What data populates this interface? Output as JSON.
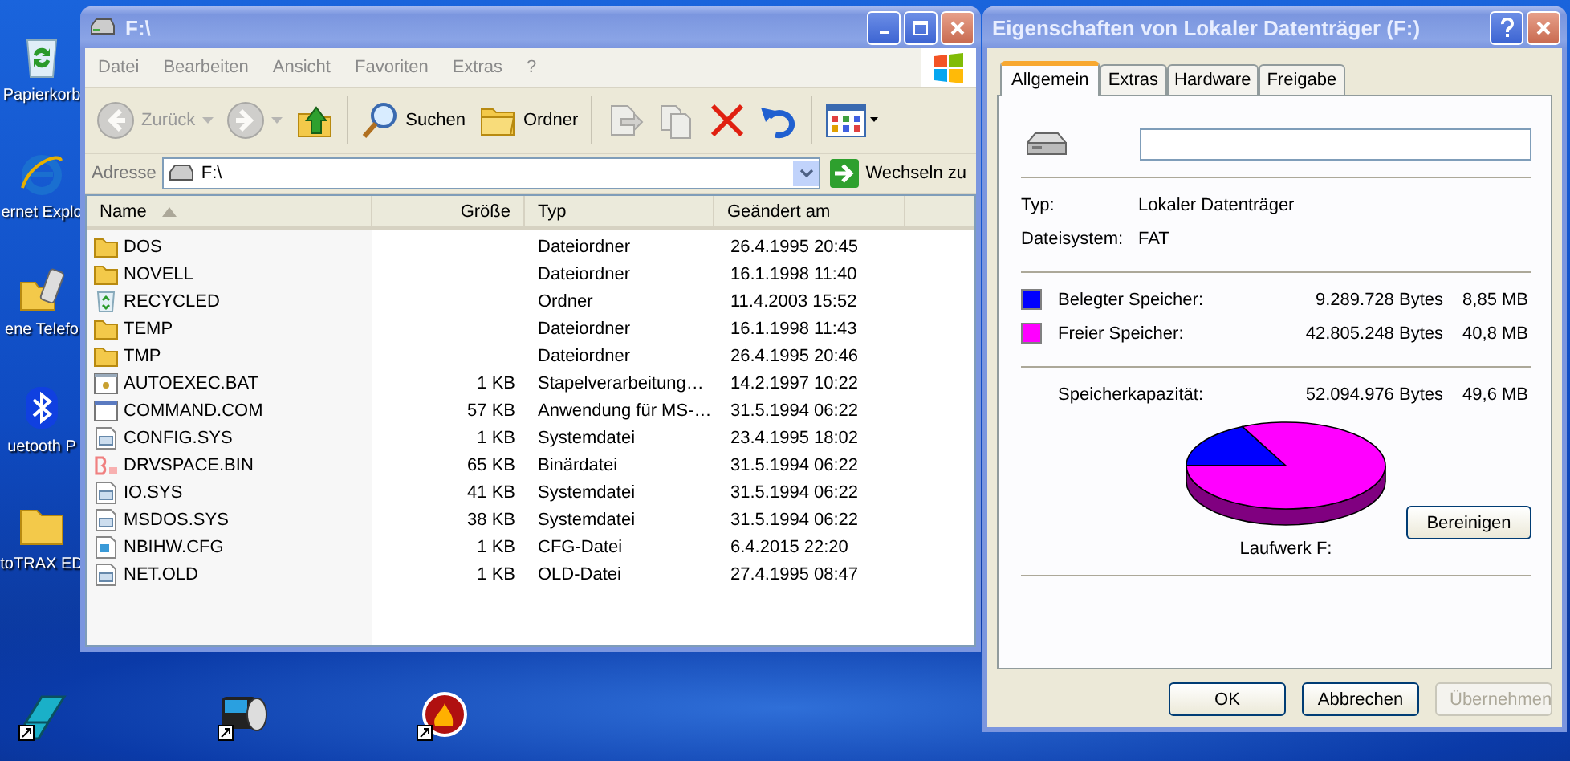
{
  "desktop_icons": [
    {
      "kind": "recycle",
      "label": "Papierkorb"
    },
    {
      "kind": "browser",
      "label": "ernet Explo"
    },
    {
      "kind": "phone",
      "label": "ene Telefo"
    },
    {
      "kind": "bluetooth",
      "label": "uetooth P"
    },
    {
      "kind": "folder",
      "label": "toTRAX ED"
    }
  ],
  "bottom_icons": [
    {
      "kind": "shortcut-cyan"
    },
    {
      "kind": "shortcut-printer"
    },
    {
      "kind": "shortcut-flame"
    }
  ],
  "explorer": {
    "title": "F:\\",
    "menu": [
      "Datei",
      "Bearbeiten",
      "Ansicht",
      "Favoriten",
      "Extras",
      "?"
    ],
    "toolbar": [
      {
        "kind": "back",
        "label": "Zurück",
        "disabled": true
      },
      {
        "kind": "forward",
        "disabled": true
      },
      {
        "kind": "up",
        "disabled": false
      },
      {
        "kind": "search",
        "label": "Suchen",
        "disabled": false
      },
      {
        "kind": "folders",
        "label": "Ordner",
        "disabled": false
      },
      {
        "kind": "move",
        "disabled": true
      },
      {
        "kind": "copy",
        "disabled": true
      },
      {
        "kind": "delete",
        "disabled": false
      },
      {
        "kind": "undo",
        "disabled": false
      },
      {
        "kind": "views",
        "disabled": false
      }
    ],
    "address": {
      "label": "Adresse",
      "value": "F:\\",
      "go": "Wechseln zu"
    },
    "columns": [
      {
        "label": "Name",
        "sorted": true
      },
      {
        "label": "Größe",
        "sorted": false
      },
      {
        "label": "Typ",
        "sorted": false
      },
      {
        "label": "Geändert am",
        "sorted": false
      }
    ],
    "rows": [
      {
        "kind": "folder",
        "name": "DOS",
        "size": "",
        "type": "Dateiordner",
        "modified": "26.4.1995 20:45"
      },
      {
        "kind": "folder",
        "name": "NOVELL",
        "size": "",
        "type": "Dateiordner",
        "modified": "16.1.1998 11:40"
      },
      {
        "kind": "recycled",
        "name": "RECYCLED",
        "size": "",
        "type": "Ordner",
        "modified": "11.4.2003 15:52"
      },
      {
        "kind": "folder",
        "name": "TEMP",
        "size": "",
        "type": "Dateiordner",
        "modified": "16.1.1998 11:43"
      },
      {
        "kind": "folder",
        "name": "TMP",
        "size": "",
        "type": "Dateiordner",
        "modified": "26.4.1995 20:46"
      },
      {
        "kind": "batch",
        "name": "AUTOEXEC.BAT",
        "size": "1 KB",
        "type": "Stapelverarbeitung…",
        "modified": "14.2.1997 10:22"
      },
      {
        "kind": "app",
        "name": "COMMAND.COM",
        "size": "57 KB",
        "type": "Anwendung für MS-…",
        "modified": "31.5.1994 06:22"
      },
      {
        "kind": "system",
        "name": "CONFIG.SYS",
        "size": "1 KB",
        "type": "Systemdatei",
        "modified": "23.4.1995 18:02"
      },
      {
        "kind": "binary",
        "name": "DRVSPACE.BIN",
        "size": "65 KB",
        "type": "Binärdatei",
        "modified": "31.5.1994 06:22"
      },
      {
        "kind": "system",
        "name": "IO.SYS",
        "size": "41 KB",
        "type": "Systemdatei",
        "modified": "31.5.1994 06:22"
      },
      {
        "kind": "system",
        "name": "MSDOS.SYS",
        "size": "38 KB",
        "type": "Systemdatei",
        "modified": "31.5.1994 06:22"
      },
      {
        "kind": "config",
        "name": "NBIHW.CFG",
        "size": "1 KB",
        "type": "CFG-Datei",
        "modified": "6.4.2015 22:20"
      },
      {
        "kind": "system",
        "name": "NET.OLD",
        "size": "1 KB",
        "type": "OLD-Datei",
        "modified": "27.4.1995 08:47"
      }
    ]
  },
  "properties": {
    "title": "Eigenschaften von Lokaler Datenträger (F:)",
    "tabs": [
      {
        "label": "Allgemein",
        "selected": true
      },
      {
        "label": "Extras",
        "selected": false
      },
      {
        "label": "Hardware",
        "selected": false
      },
      {
        "label": "Freigabe",
        "selected": false
      }
    ],
    "info": [
      {
        "label": "Typ:",
        "value": "Lokaler Datenträger"
      },
      {
        "label": "Dateisystem:",
        "value": "FAT"
      }
    ],
    "legend": [
      {
        "label": "Belegter Speicher:",
        "bytes": "9.289.728 Bytes",
        "size": "8,85 MB",
        "color": "#0000ff"
      },
      {
        "label": "Freier Speicher:",
        "bytes": "42.805.248 Bytes",
        "size": "40,8 MB",
        "color": "#ff00ff"
      }
    ],
    "capacity": {
      "label": "Speicherkapazität:",
      "bytes": "52.094.976 Bytes",
      "size": "49,6 MB"
    },
    "drive_label": "Laufwerk F:",
    "cleanup": "Bereinigen",
    "buttons": [
      {
        "label": "OK",
        "disabled": false
      },
      {
        "label": "Abbrechen",
        "disabled": false
      },
      {
        "label": "Übernehmen",
        "disabled": true
      }
    ]
  }
}
